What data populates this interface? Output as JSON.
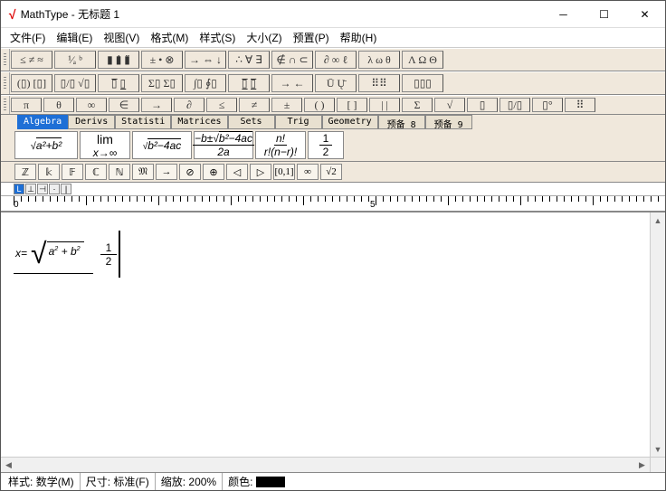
{
  "window": {
    "app": "MathType",
    "title": "无标题 1"
  },
  "menu": {
    "file": "文件(F)",
    "edit": "编辑(E)",
    "view": "视图(V)",
    "format": "格式(M)",
    "style": "样式(S)",
    "size": "大小(Z)",
    "preset": "预置(P)",
    "help": "帮助(H)"
  },
  "palette_row1": [
    "≤ ≠ ≈",
    "¹⁄ₐ ᵇ",
    "▮ ▮̇ ▮̈",
    "± • ⊗",
    "→ ⇔ ↓",
    "∴ ∀ ∃",
    "∉ ∩ ⊂",
    "∂ ∞ ℓ",
    "λ ω θ",
    "Λ Ω Θ"
  ],
  "palette_row2": [
    "(▯) [▯]",
    "▯/▯ √▯",
    "▯̅ ▯̲",
    "Σ▯ Σ▯",
    "∫▯ ∮▯",
    "▯̲̅ ▯̲̅",
    "→ ←",
    "Ū Ų̄",
    "⠿⠿",
    "▯▯▯"
  ],
  "palette_row3": [
    "π",
    "θ",
    "∞",
    "∈",
    "→",
    "∂",
    "≤",
    "≠",
    "±",
    "( )",
    "[ ]",
    "| |",
    "Σ",
    "√",
    "▯",
    "▯/▯",
    "▯°",
    "⠿"
  ],
  "tabs": [
    "Algebra",
    "Derivs",
    "Statisti",
    "Matrices",
    "Sets",
    "Trig",
    "Geometry",
    "预备 8",
    "预备 9"
  ],
  "active_tab": 0,
  "templates": [
    "√(a²+b²)",
    "lim x→∞",
    "√(b²−4ac)",
    "(−b±√(b²−4ac))/2a",
    "n!/(r!(n−r)!)",
    "1/2"
  ],
  "small_symbols": [
    "ℤ",
    "𝕜",
    "𝔽",
    "ℂ",
    "ℕ",
    "𝔐",
    "→",
    "⊘",
    "⊕",
    "◁",
    "▷",
    "[0,1]",
    "∞",
    "√2"
  ],
  "ruler": {
    "marks": [
      "0",
      "5"
    ]
  },
  "equation": {
    "lhs": "x=",
    "sqrt_body": "a² + b²",
    "frac_num": "1",
    "frac_den": "2"
  },
  "status": {
    "style_label": "样式:",
    "style_value": "数学(M)",
    "size_label": "尺寸:",
    "size_value": "标准(F)",
    "zoom_label": "缩放:",
    "zoom_value": "200%",
    "color_label": "颜色:"
  }
}
